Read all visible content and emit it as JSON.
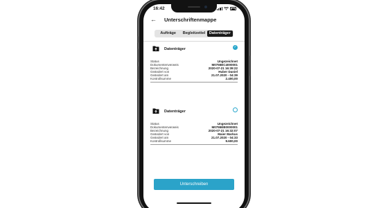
{
  "status_bar": {
    "time": "16:42"
  },
  "header": {
    "back": "←",
    "title": "Unterschriftenmappe"
  },
  "tabs": [
    {
      "label": "Aufträge",
      "active": false
    },
    {
      "label": "Begleitzettel",
      "active": false
    },
    {
      "label": "Datenträger",
      "active": true
    }
  ],
  "documents": [
    {
      "title": "Datenträger",
      "checked": true,
      "check_icon": "✓",
      "rows": [
        {
          "key": "Status",
          "value": "Ungezeichnet"
        },
        {
          "key": "Dokumentenverweis",
          "value": "M0755EC4000001"
        },
        {
          "key": "Bezeichnung",
          "value": "2020-07-21 16:39:22"
        },
        {
          "key": "Geändert von",
          "value": "Huber Daniel"
        },
        {
          "key": "Geändert am",
          "value": "21.07.2020 - 04:39"
        },
        {
          "key": "Kontrollsumme",
          "value": "2.400,00"
        }
      ]
    },
    {
      "title": "Datenträger",
      "checked": false,
      "check_icon": "",
      "rows": [
        {
          "key": "Status",
          "value": "Ungezeichnet"
        },
        {
          "key": "Dokumentenverweis",
          "value": "M0755EB0000001"
        },
        {
          "key": "Bezeichnung",
          "value": "2020-07-21 16:32:07"
        },
        {
          "key": "Geändert von",
          "value": "Maier Markus"
        },
        {
          "key": "Geändert am",
          "value": "21.07.2020 - 04:33"
        },
        {
          "key": "Kontrollsumme",
          "value": "9.600,00"
        }
      ]
    }
  ],
  "sign_button": {
    "label": "Unterschreiben"
  },
  "colors": {
    "accent": "#2ba3c9",
    "tab_active": "#1a1a1a"
  }
}
